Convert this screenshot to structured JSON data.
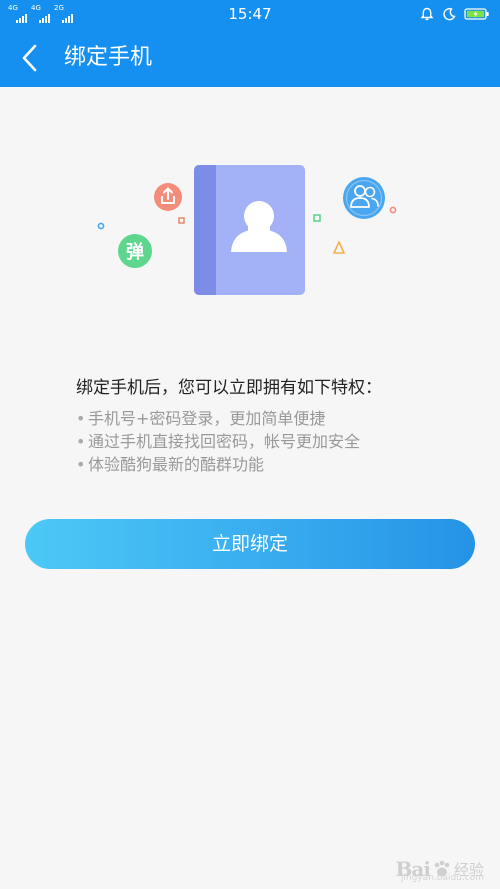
{
  "status_bar": {
    "network_1": "4G",
    "network_2": "4G",
    "network_3": "2G",
    "time": "15:47",
    "icons": [
      "alarm-bell-icon",
      "moon-icon",
      "battery-charging-icon"
    ],
    "battery_color": "#7ee04a"
  },
  "app_bar": {
    "title": "绑定手机",
    "back_icon": "chevron-left-icon",
    "background": "#1690f0"
  },
  "illustration": {
    "badge_text": "弹",
    "icons": [
      "contact-book-icon",
      "share-upload-icon",
      "group-users-icon",
      "bullet-badge-icon"
    ]
  },
  "content": {
    "intro": "绑定手机后，您可以立即拥有如下特权：",
    "features": [
      "手机号+密码登录，更加简单便捷",
      "通过手机直接找回密码，帐号更加安全",
      "体验酷狗最新的酷群功能"
    ],
    "bullet": "•"
  },
  "actions": {
    "bind_now": "立即绑定"
  },
  "watermark": {
    "brand": "Bai",
    "brand_suffix": "经验",
    "sub": "jingyan.baidu.com"
  }
}
